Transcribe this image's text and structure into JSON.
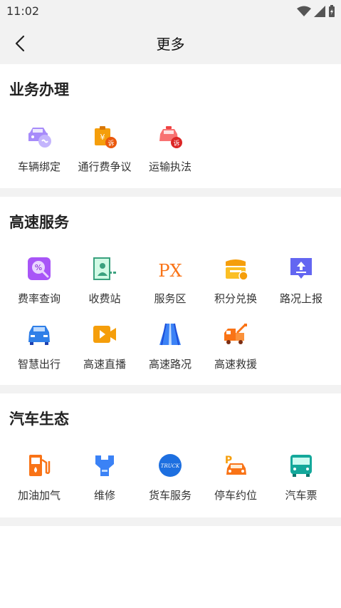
{
  "status_bar": {
    "time": "11:02"
  },
  "header": {
    "title": "更多"
  },
  "sections": [
    {
      "title": "业务办理",
      "items": [
        {
          "label": "车辆绑定",
          "icon": "car-link-icon"
        },
        {
          "label": "通行费争议",
          "icon": "toll-dispute-icon"
        },
        {
          "label": "运输执法",
          "icon": "transport-enforcement-icon"
        }
      ]
    },
    {
      "title": "高速服务",
      "items": [
        {
          "label": "费率查询",
          "icon": "rate-query-icon"
        },
        {
          "label": "收费站",
          "icon": "toll-station-icon"
        },
        {
          "label": "服务区",
          "icon": "service-area-icon"
        },
        {
          "label": "积分兑换",
          "icon": "points-exchange-icon"
        },
        {
          "label": "路况上报",
          "icon": "road-report-icon"
        },
        {
          "label": "智慧出行",
          "icon": "smart-travel-icon"
        },
        {
          "label": "高速直播",
          "icon": "live-video-icon"
        },
        {
          "label": "高速路况",
          "icon": "highway-road-icon"
        },
        {
          "label": "高速救援",
          "icon": "rescue-truck-icon"
        }
      ]
    },
    {
      "title": "汽车生态",
      "items": [
        {
          "label": "加油加气",
          "icon": "fuel-pump-icon"
        },
        {
          "label": "维修",
          "icon": "repair-icon"
        },
        {
          "label": "货车服务",
          "icon": "truck-service-icon"
        },
        {
          "label": "停车约位",
          "icon": "parking-icon"
        },
        {
          "label": "汽车票",
          "icon": "bus-ticket-icon"
        }
      ]
    }
  ],
  "icon_texts": {
    "rate": "%",
    "toll_dispute_badge": "诉",
    "enforcement_badge": "诉",
    "service_area": "PX",
    "truck_logo": "TRUCK",
    "parking": "P"
  },
  "colors": {
    "purple": "#8b5cf6",
    "orange": "#f59e0b",
    "red": "#ef4444",
    "blue": "#2f7fe8",
    "teal": "#14a89b",
    "green": "#3aa17e"
  }
}
